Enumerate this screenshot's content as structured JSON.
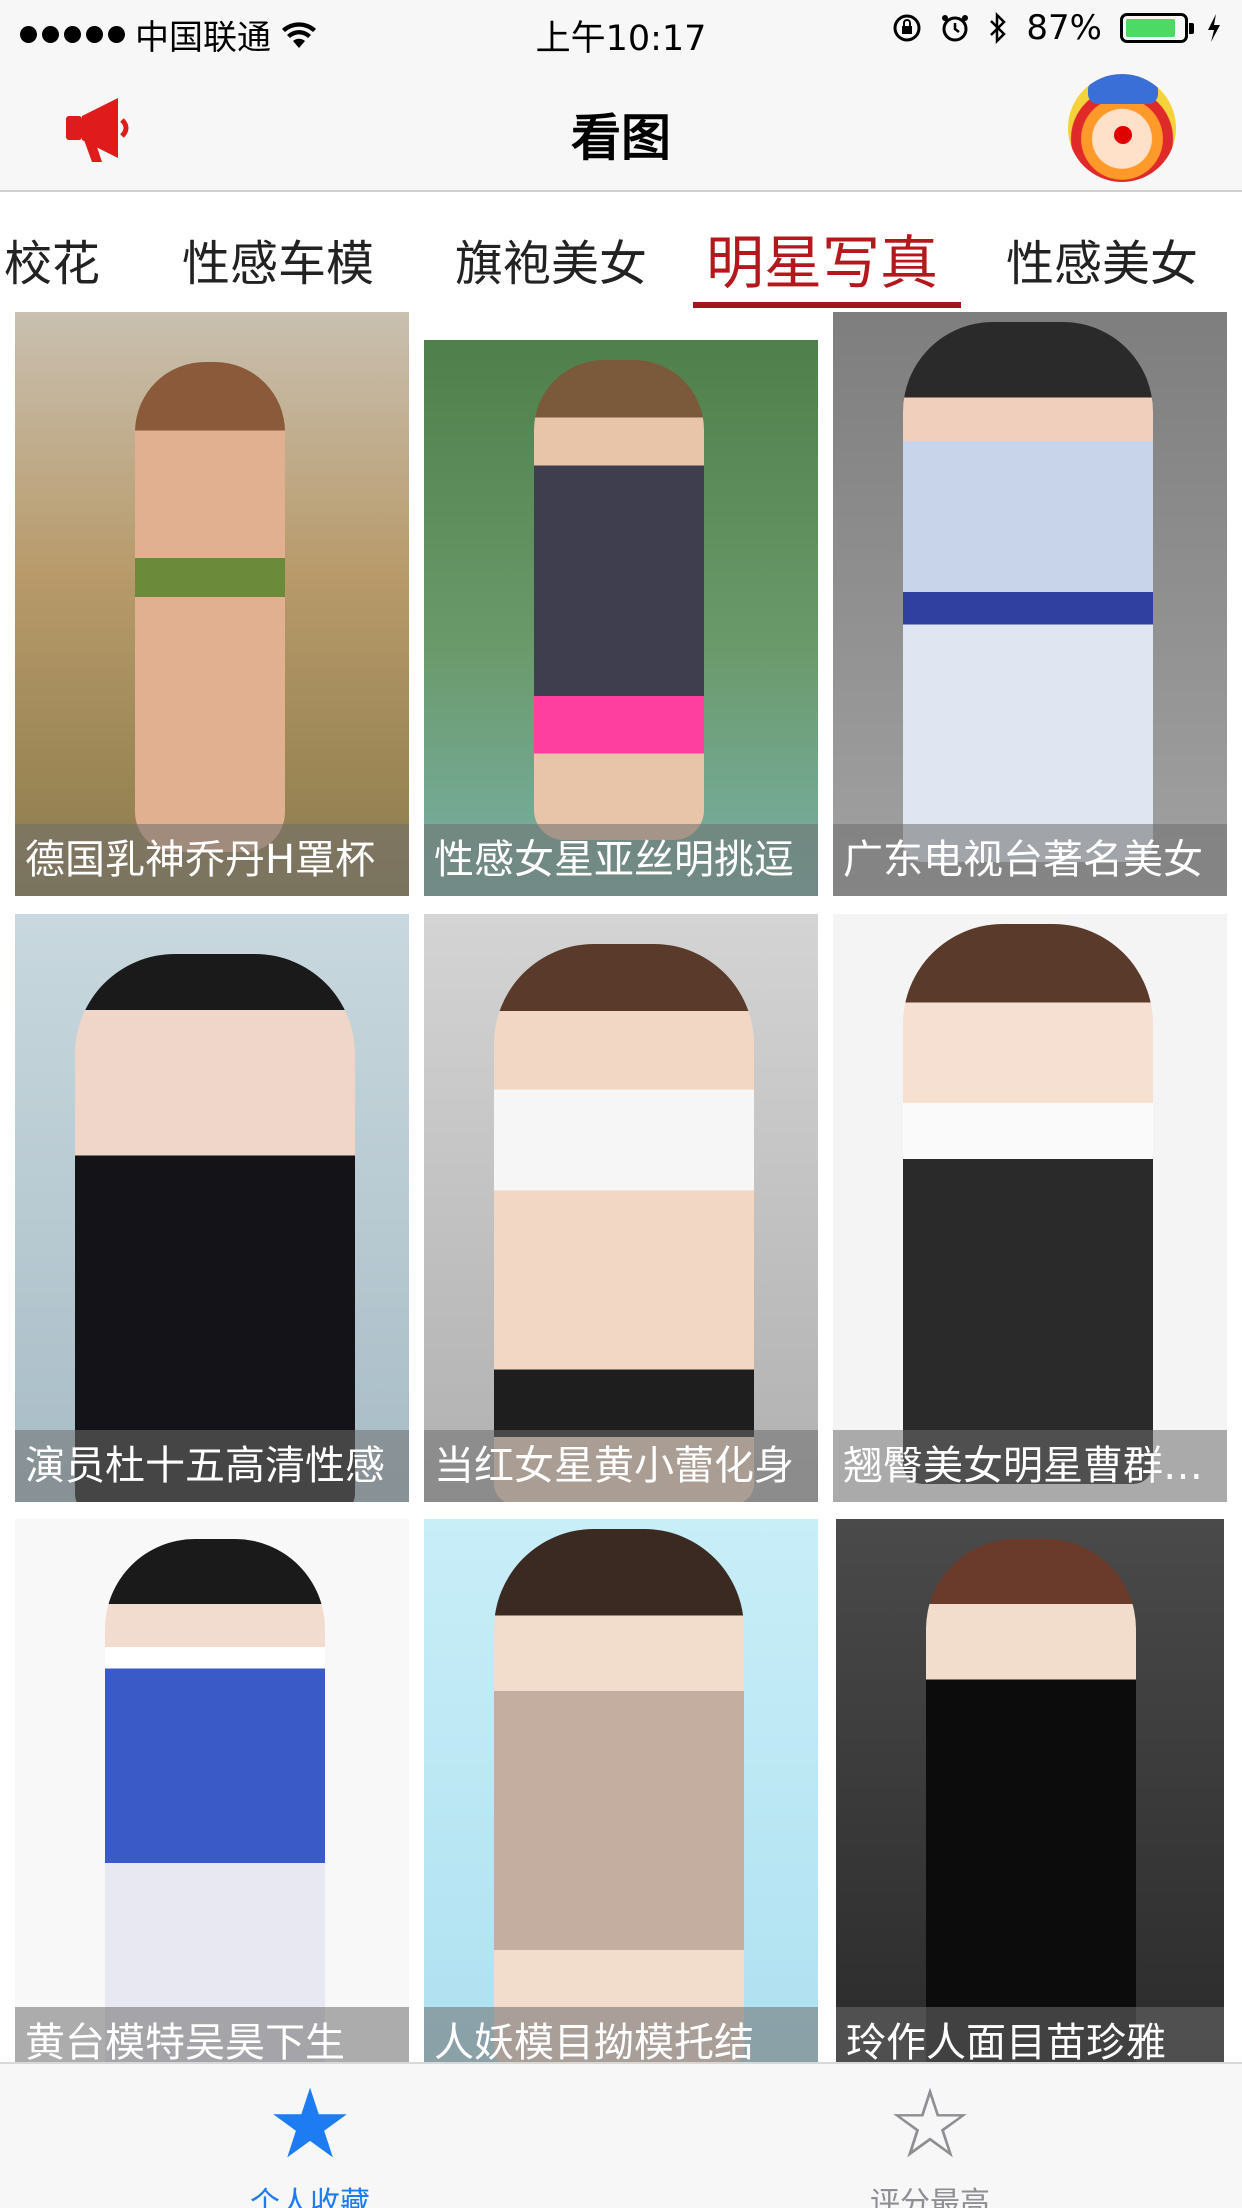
{
  "status_bar": {
    "carrier": "中国联通",
    "time": "上午10:17",
    "battery_percent": "87%",
    "battery_level": 0.87,
    "icons": [
      "signal-dots",
      "wifi-icon",
      "orientation-lock-icon",
      "alarm-icon",
      "bluetooth-icon",
      "battery-icon",
      "charging-bolt-icon"
    ]
  },
  "nav": {
    "title": "看图",
    "left_icon": "megaphone-icon",
    "right_icon": "clown-avatar"
  },
  "tabs": {
    "items": [
      {
        "label": "校花",
        "active": false
      },
      {
        "label": "性感车模",
        "active": false
      },
      {
        "label": "旗袍美女",
        "active": false
      },
      {
        "label": "明星写真",
        "active": true
      },
      {
        "label": "性感美女",
        "active": false
      }
    ],
    "active_color": "#b3181c"
  },
  "grid": {
    "items": [
      {
        "caption": "德国乳神乔丹H罩杯",
        "bg": "#b89a6a",
        "accent": "#6b8a3a"
      },
      {
        "caption": "性感女星亚丝明挑逗",
        "bg": "#5a8a5a",
        "accent": "#3e3e4e"
      },
      {
        "caption": "广东电视台著名美女",
        "bg": "#8a8a8a",
        "accent": "#c8d4ea"
      },
      {
        "caption": "演员杜十五高清性感",
        "bg": "#b8c8d2",
        "accent": "#141418"
      },
      {
        "caption": "当红女星黄小蕾化身",
        "bg": "#c2c2c2",
        "accent": "#f2f2f2"
      },
      {
        "caption": "翘臀美女明星曹群写真",
        "bg": "#f4f4f4",
        "accent": "#222222"
      },
      {
        "caption": "黄台模特吴昊下生",
        "bg": "#f8f8f8",
        "accent": "#3a5ac8"
      },
      {
        "caption": "人妖模目拗模托结",
        "bg": "#bfe8f4",
        "accent": "#c4aea0"
      },
      {
        "caption": "玲作人面目苗珍雅",
        "bg": "#3a3a3a",
        "accent": "#0c0c0c"
      }
    ]
  },
  "bottom_tabs": [
    {
      "label": "个人收藏",
      "icon": "star-filled-icon",
      "glyph": "★",
      "active": true
    },
    {
      "label": "评分最高",
      "icon": "star-outline-icon",
      "glyph": "☆",
      "active": false
    }
  ],
  "colors": {
    "accent_blue": "#1e7cf2",
    "accent_red": "#b3181c",
    "battery_green": "#4cd964"
  }
}
